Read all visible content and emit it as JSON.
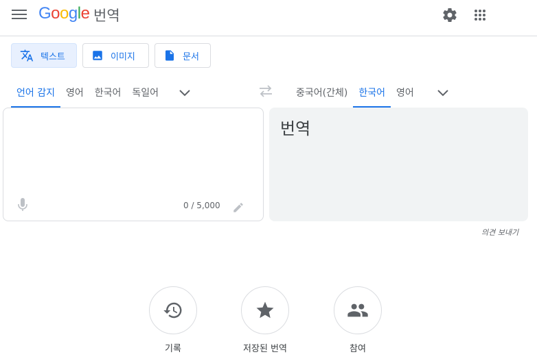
{
  "header": {
    "logo_parts": [
      "G",
      "o",
      "o",
      "g",
      "l",
      "e"
    ],
    "app_name": "번역"
  },
  "modes": [
    {
      "label": "텍스트",
      "icon": "translate-icon",
      "active": true
    },
    {
      "label": "이미지",
      "icon": "image-icon",
      "active": false
    },
    {
      "label": "문서",
      "icon": "document-icon",
      "active": false
    }
  ],
  "source_langs": [
    "언어 감지",
    "영어",
    "한국어",
    "독일어"
  ],
  "target_langs": [
    "중국어(간체)",
    "한국어",
    "영어"
  ],
  "source": {
    "counter": "0 / 5,000"
  },
  "target": {
    "placeholder": "번역"
  },
  "feedback": "의견 보내기",
  "bottom_actions": [
    {
      "label": "기록",
      "icon": "history-icon"
    },
    {
      "label": "저장된 번역",
      "icon": "star-icon"
    },
    {
      "label": "참여",
      "icon": "people-icon"
    }
  ],
  "colors": {
    "accent": "#1a73e8",
    "border": "#dadce0",
    "target_bg": "#f1f3f4"
  }
}
